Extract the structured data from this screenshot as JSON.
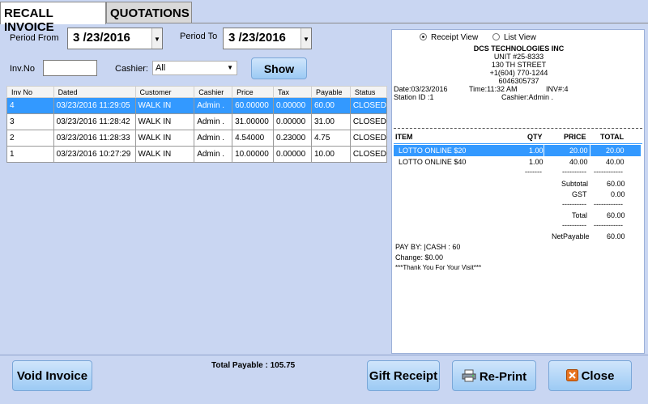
{
  "tabs": [
    {
      "label": "RECALL INVOICE",
      "active": true
    },
    {
      "label": "QUOTATIONS",
      "active": false
    }
  ],
  "filters": {
    "period_from_label": "Period From",
    "period_from_value": "3 /23/2016",
    "period_to_label": "Period To",
    "period_to_value": "3 /23/2016",
    "invno_label": "Inv.No",
    "invno_value": "",
    "cashier_label": "Cashier:",
    "cashier_value": "All",
    "show_label": "Show"
  },
  "grid": {
    "headers": [
      "Inv No",
      "Dated",
      "Customer",
      "Cashier",
      "Price",
      "Tax",
      "Payable",
      "Status"
    ],
    "rows": [
      [
        "4",
        "03/23/2016 11:29:05",
        "WALK IN",
        "Admin .",
        "60.00000",
        "0.00000",
        "60.00",
        "CLOSED"
      ],
      [
        "3",
        "03/23/2016 11:28:42",
        "WALK IN",
        "Admin .",
        "31.00000",
        "0.00000",
        "31.00",
        "CLOSED"
      ],
      [
        "2",
        "03/23/2016 11:28:33",
        "WALK IN",
        "Admin .",
        "4.54000",
        "0.23000",
        "4.75",
        "CLOSED"
      ],
      [
        "1",
        "03/23/2016 10:27:29",
        "WALK IN",
        "Admin .",
        "10.00000",
        "0.00000",
        "10.00",
        "CLOSED"
      ]
    ]
  },
  "view": {
    "receipt_label": "Receipt View",
    "list_label": "List View"
  },
  "receipt": {
    "company": "DCS TECHNOLOGIES INC",
    "unit": "UNIT #25-8333",
    "street": "130 TH STREET",
    "phone1": "+1(604) 770-1244",
    "phone2": "6046305737",
    "date": "Date:03/23/2016",
    "time": "Time:11:32 AM",
    "inv": "INV#:4",
    "station": "Station ID :1",
    "cashier": "Cashier:Admin .",
    "col_item": "ITEM",
    "col_qty": "QTY",
    "col_price": "PRICE",
    "col_total": "TOTAL",
    "items": [
      {
        "name": "LOTTO ONLINE $20",
        "qty": "1.00",
        "price": "20.00",
        "total": "20.00"
      },
      {
        "name": "LOTTO ONLINE $40",
        "qty": "1.00",
        "price": "40.00",
        "total": "40.00"
      }
    ],
    "dash_short": "-------",
    "dash_mid": "----------",
    "dash_long": "------------",
    "subtotal_label": "Subtotal",
    "subtotal_value": "60.00",
    "gst_label": "GST",
    "gst_value": "0.00",
    "total_label": "Total",
    "total_value": "60.00",
    "netpayable_label": "NetPayable",
    "netpayable_value": "60.00",
    "payby": "PAY BY: |CASH : 60",
    "change": "Change: $0.00",
    "thanks": "***Thank You For Your Visit***"
  },
  "footer": {
    "void_label": "Void Invoice",
    "total_payable": "Total Payable : 105.75",
    "gift_label": "Gift Receipt",
    "reprint_label": "Re-Print",
    "close_label": "Close"
  }
}
